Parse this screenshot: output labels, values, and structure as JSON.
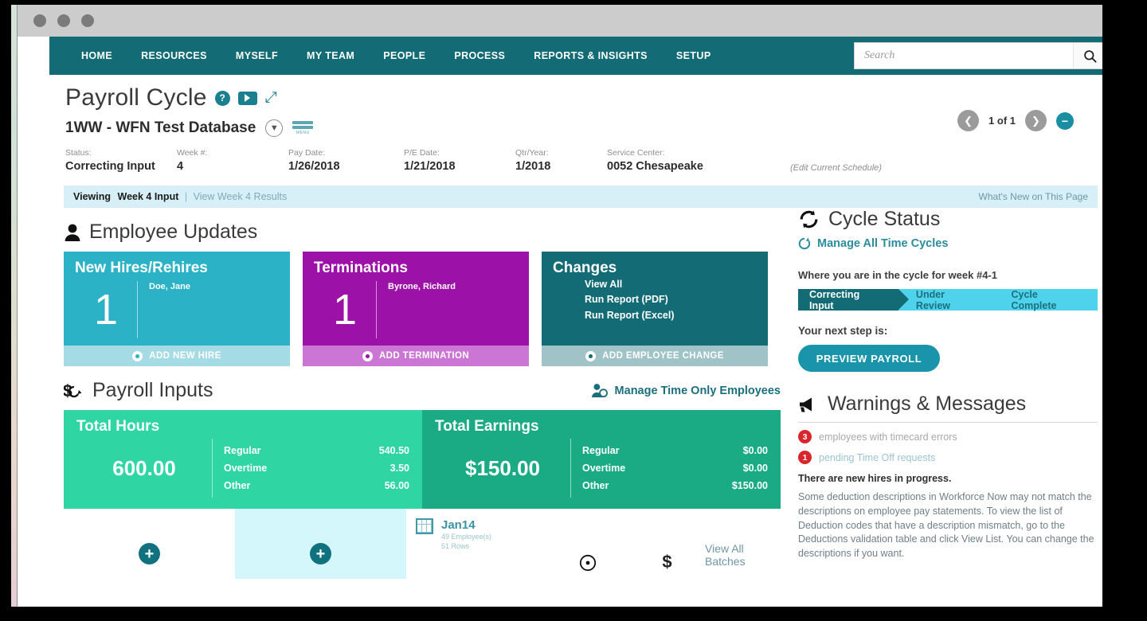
{
  "nav": {
    "items": [
      "HOME",
      "RESOURCES",
      "MYSELF",
      "MY TEAM",
      "PEOPLE",
      "PROCESS",
      "REPORTS & INSIGHTS",
      "SETUP"
    ],
    "search_placeholder": "Search",
    "search_value": ""
  },
  "header": {
    "title": "Payroll Cycle",
    "database": "1WW - WFN Test Database",
    "menu_label": "MENU",
    "pager_text": "1 of 1",
    "edit_schedule": "(Edit Current Schedule)",
    "meta": [
      {
        "label": "Status:",
        "value": "Correcting Input"
      },
      {
        "label": "Week #:",
        "value": "4"
      },
      {
        "label": "Pay Date:",
        "value": "1/26/2018"
      },
      {
        "label": "P/E Date:",
        "value": "1/21/2018"
      },
      {
        "label": "Qtr/Year:",
        "value": "1/2018"
      },
      {
        "label": "Service Center:",
        "value": "0052  Chesapeake"
      }
    ]
  },
  "viewbar": {
    "viewing_label": "Viewing",
    "viewing_value": "Week 4 Input",
    "separator": "|",
    "results_link": "View Week 4 Results",
    "whats_new": "What's New on This Page"
  },
  "employee_updates": {
    "section_title": "Employee Updates",
    "cards": [
      {
        "title": "New Hires/Rehires",
        "count": "1",
        "detail": "Doe, Jane",
        "action": "ADD NEW HIRE"
      },
      {
        "title": "Terminations",
        "count": "1",
        "detail": "Byrone, Richard",
        "action": "ADD TERMINATION"
      },
      {
        "title": "Changes",
        "links": [
          "View All",
          "Run Report (PDF)",
          "Run Report (Excel)"
        ],
        "action": "ADD EMPLOYEE CHANGE"
      }
    ]
  },
  "payroll_inputs": {
    "section_title": "Payroll Inputs",
    "manage_link": "Manage Time Only Employees",
    "total_hours": {
      "title": "Total Hours",
      "total": "600.00",
      "rows": [
        {
          "label": "Regular",
          "value": "540.50"
        },
        {
          "label": "Overtime",
          "value": "3.50"
        },
        {
          "label": "Other",
          "value": "56.00"
        }
      ]
    },
    "total_earnings": {
      "title": "Total Earnings",
      "total": "$150.00",
      "rows": [
        {
          "label": "Regular",
          "value": "$0.00"
        },
        {
          "label": "Overtime",
          "value": "$0.00"
        },
        {
          "label": "Other",
          "value": "$150.00"
        }
      ]
    },
    "batch": {
      "name": "Jan14",
      "employees": "49 Employee(s)",
      "rows": "51 Rows",
      "view_all": "View All Batches"
    }
  },
  "cycle_status": {
    "title": "Cycle Status",
    "manage_all": "Manage All Time Cycles",
    "where_text": "Where you are in the cycle for week #4-1",
    "steps": [
      "Correcting Input",
      "Under Review",
      "Cycle Complete"
    ],
    "active_step_index": 0,
    "next_step_label": "Your next step is:",
    "next_step_button": "PREVIEW PAYROLL"
  },
  "warnings": {
    "title": "Warnings & Messages",
    "items": [
      {
        "badge": "3",
        "text": "employees with timecard errors",
        "style": "gray"
      },
      {
        "badge": "1",
        "text": "pending Time Off requests",
        "style": "blue"
      }
    ],
    "notice": "There are new hires in progress.",
    "paragraph": "Some deduction descriptions in Workforce Now may not match the descriptions on employee pay statements. To view the list of Deduction codes that have a description mismatch, go to the Deductions validation table and click View List. You can change the descriptions if you want."
  },
  "colors": {
    "brand_teal": "#136b75",
    "cyan_card": "#2cb2c7",
    "purple_card": "#9c12a8",
    "green_light": "#2fd6a4",
    "green_dark": "#1aab84",
    "accent_blue": "#1a94ab",
    "alert_red": "#d8262c"
  }
}
